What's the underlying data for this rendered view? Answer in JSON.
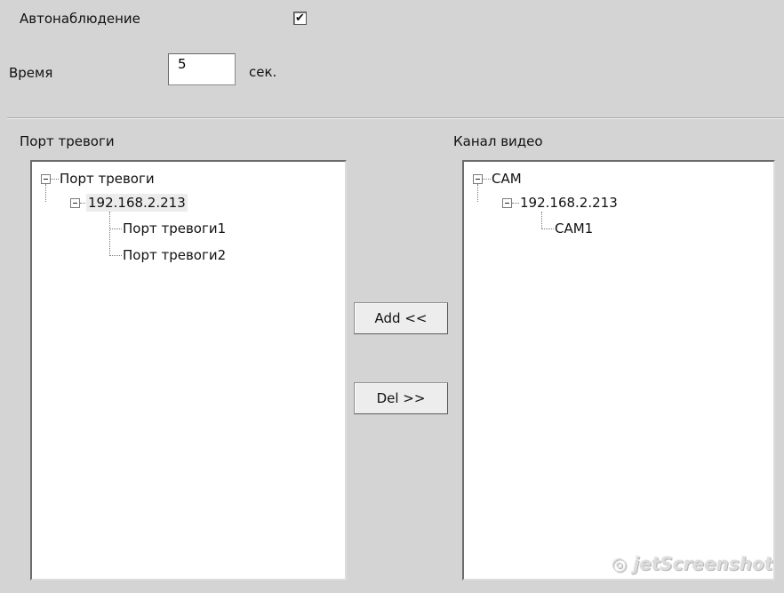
{
  "settings": {
    "auto_watch_label": "Автонаблюдение",
    "auto_watch_checked": true,
    "checkbox_mark": "✔",
    "time_label": "Время",
    "time_value": "5",
    "time_unit": "сек."
  },
  "left_panel": {
    "title": "Порт тревоги",
    "root": "Порт тревоги",
    "device": "192.168.2.213",
    "children": [
      "Порт тревоги1",
      "Порт тревоги2"
    ]
  },
  "right_panel": {
    "title": "Канал видео",
    "root": "CAM",
    "device": "192.168.2.213",
    "children": [
      "CAM1"
    ]
  },
  "buttons": {
    "add": "Add <<",
    "del": "Del >>"
  },
  "watermark": {
    "text": "jetScreenshot",
    "glyph": "◎"
  }
}
